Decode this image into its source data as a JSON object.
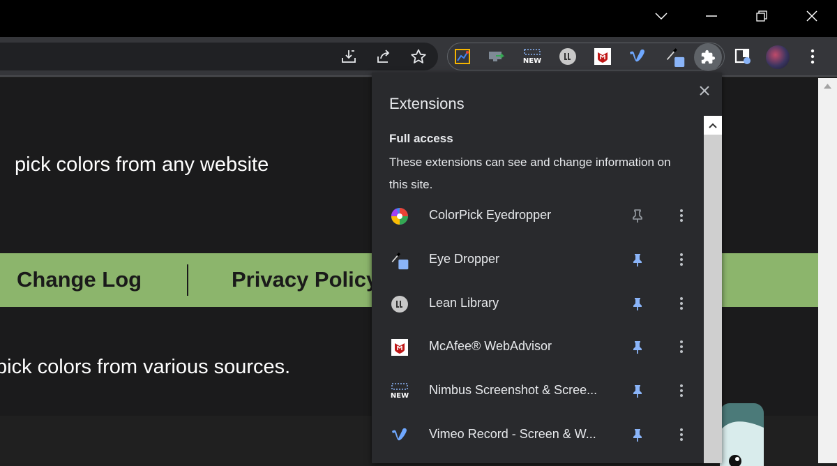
{
  "window": {
    "minimize_label": "Minimize",
    "maximize_label": "Restore",
    "close_label": "Close",
    "tabsearch_icon": "chevron-down-icon"
  },
  "toolbar": {
    "actions": [
      "install-icon",
      "share-icon",
      "bookmark-star-icon"
    ],
    "pinned_extensions": [
      "colorpick-eyedropper-icon",
      "screen-record-icon",
      "nimbus-new-icon",
      "lean-library-icon",
      "mcafee-icon",
      "vimeo-icon",
      "eye-dropper-icon",
      "extensions-puzzle-icon",
      "side-panel-icon",
      "profile-avatar",
      "more-menu-icon"
    ]
  },
  "page": {
    "tagline": "pick colors from any website",
    "nav": {
      "change_log": "Change Log",
      "privacy_policy": "Privacy Policy"
    },
    "subtitle": "pick colors from various sources."
  },
  "extensions_popup": {
    "title": "Extensions",
    "section_title": "Full access",
    "section_description": "These extensions can see and change information on this site.",
    "items": [
      {
        "name": "ColorPick Eyedropper",
        "pinned": false,
        "icon": "colorpick-icon"
      },
      {
        "name": "Eye Dropper",
        "pinned": true,
        "icon": "eye-dropper-icon"
      },
      {
        "name": "Lean Library",
        "pinned": true,
        "icon": "lean-library-icon"
      },
      {
        "name": "McAfee® WebAdvisor",
        "pinned": true,
        "icon": "mcafee-icon"
      },
      {
        "name": "Nimbus Screenshot & Scree...",
        "pinned": true,
        "icon": "nimbus-icon"
      },
      {
        "name": "Vimeo Record - Screen & W...",
        "pinned": true,
        "icon": "vimeo-icon"
      }
    ]
  },
  "colors": {
    "accent_green": "#8cb56c",
    "pin_active": "#8ab4f8",
    "pin_inactive": "#9aa0a6",
    "popup_bg": "#292a2d"
  }
}
